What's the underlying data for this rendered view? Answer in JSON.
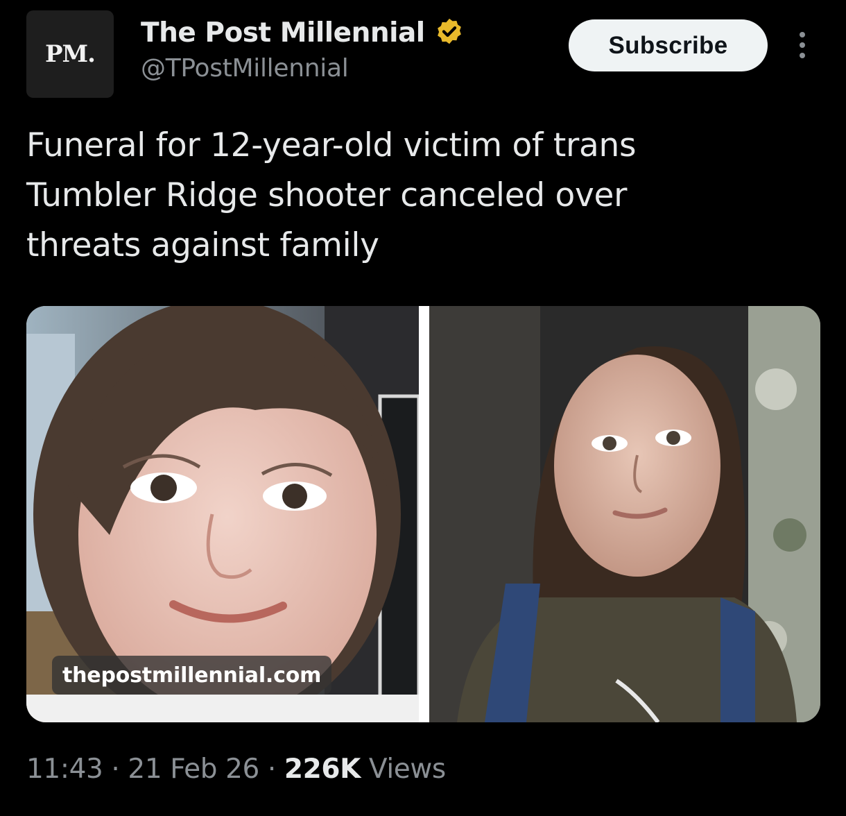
{
  "account": {
    "avatar_text": "PM.",
    "display_name": "The Post Millennial",
    "handle": "@TPostMillennial",
    "verified_color": "#e8b92b"
  },
  "actions": {
    "subscribe_label": "Subscribe",
    "more_icon": "more-vertical-icon"
  },
  "tweet": {
    "text": "Funeral for 12-year-old victim of trans Tumbler Ridge shooter canceled over threats against family",
    "media": {
      "watermark": "thepostmillennial.com",
      "left_image": "photo-smiling-girl",
      "right_image": "photo-long-haired-person"
    },
    "meta": {
      "time": "11:43",
      "separator": " · ",
      "date": "21 Feb 26",
      "views_count": "226K",
      "views_label": " Views"
    }
  },
  "colors": {
    "background": "#000000",
    "text_primary": "#e7e9ea",
    "text_secondary": "#8b9095",
    "button_bg": "#eff3f4"
  }
}
